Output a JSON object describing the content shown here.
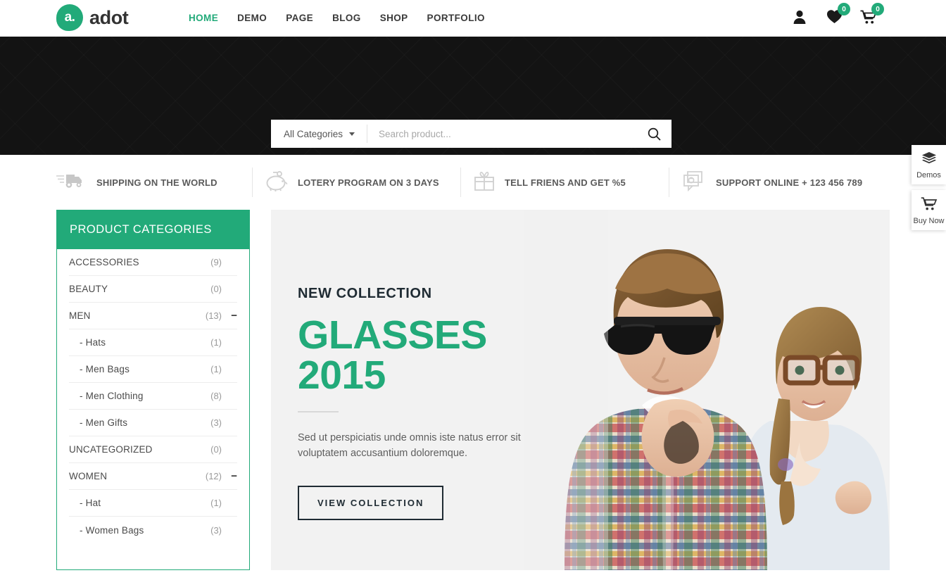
{
  "header": {
    "logo": {
      "mark_text": "a.",
      "brand": "adot"
    },
    "nav": [
      {
        "label": "HOME",
        "active": true
      },
      {
        "label": "DEMO",
        "active": false
      },
      {
        "label": "PAGE",
        "active": false
      },
      {
        "label": "BLOG",
        "active": false
      },
      {
        "label": "SHOP",
        "active": false
      },
      {
        "label": "PORTFOLIO",
        "active": false
      }
    ],
    "icons": {
      "account": "user-icon",
      "wishlist": {
        "icon": "heart-icon",
        "count": "0"
      },
      "cart": {
        "icon": "cart-icon",
        "count": "0"
      }
    }
  },
  "search": {
    "category_label": "All Categories",
    "placeholder": "Search product...",
    "value": "",
    "button_icon": "search-icon"
  },
  "features": [
    {
      "icon": "truck-icon",
      "label": "SHIPPING ON THE WORLD"
    },
    {
      "icon": "piggy-bank-icon",
      "label": "LOTERY PROGRAM ON 3 DAYS"
    },
    {
      "icon": "gift-icon",
      "label": "TELL FRIENS AND GET %5"
    },
    {
      "icon": "support-chat-icon",
      "label": "SUPPORT ONLINE + 123 456 789"
    }
  ],
  "sidebar": {
    "title": "PRODUCT CATEGORIES",
    "items": [
      {
        "label": "ACCESSORIES",
        "count": "(9)",
        "sub": false,
        "toggle": ""
      },
      {
        "label": "BEAUTY",
        "count": "(0)",
        "sub": false,
        "toggle": ""
      },
      {
        "label": "MEN",
        "count": "(13)",
        "sub": false,
        "toggle": "−"
      },
      {
        "label": "- Hats",
        "count": "(1)",
        "sub": true,
        "toggle": ""
      },
      {
        "label": "- Men Bags",
        "count": "(1)",
        "sub": true,
        "toggle": ""
      },
      {
        "label": "- Men Clothing",
        "count": "(8)",
        "sub": true,
        "toggle": ""
      },
      {
        "label": "- Men Gifts",
        "count": "(3)",
        "sub": true,
        "toggle": ""
      },
      {
        "label": "UNCATEGORIZED",
        "count": "(0)",
        "sub": false,
        "toggle": ""
      },
      {
        "label": "WOMEN",
        "count": "(12)",
        "sub": false,
        "toggle": "−"
      },
      {
        "label": "- Hat",
        "count": "(1)",
        "sub": true,
        "toggle": ""
      },
      {
        "label": "- Women Bags",
        "count": "(3)",
        "sub": true,
        "toggle": ""
      }
    ]
  },
  "hero": {
    "kicker": "NEW COLLECTION",
    "title": "GLASSES 2015",
    "description": "Sed ut perspiciatis unde omnis iste natus error sit voluptatem accusantium doloremque.",
    "button_label": "VIEW COLLECTION"
  },
  "float_tabs": [
    {
      "icon": "layers-icon",
      "label": "Demos"
    },
    {
      "icon": "cart-icon",
      "label": "Buy Now"
    }
  ],
  "colors": {
    "brand_green": "#22aa79",
    "dark_banner": "#131313",
    "hero_bg": "#f2f2f2",
    "heading_dark": "#1f2b33"
  }
}
